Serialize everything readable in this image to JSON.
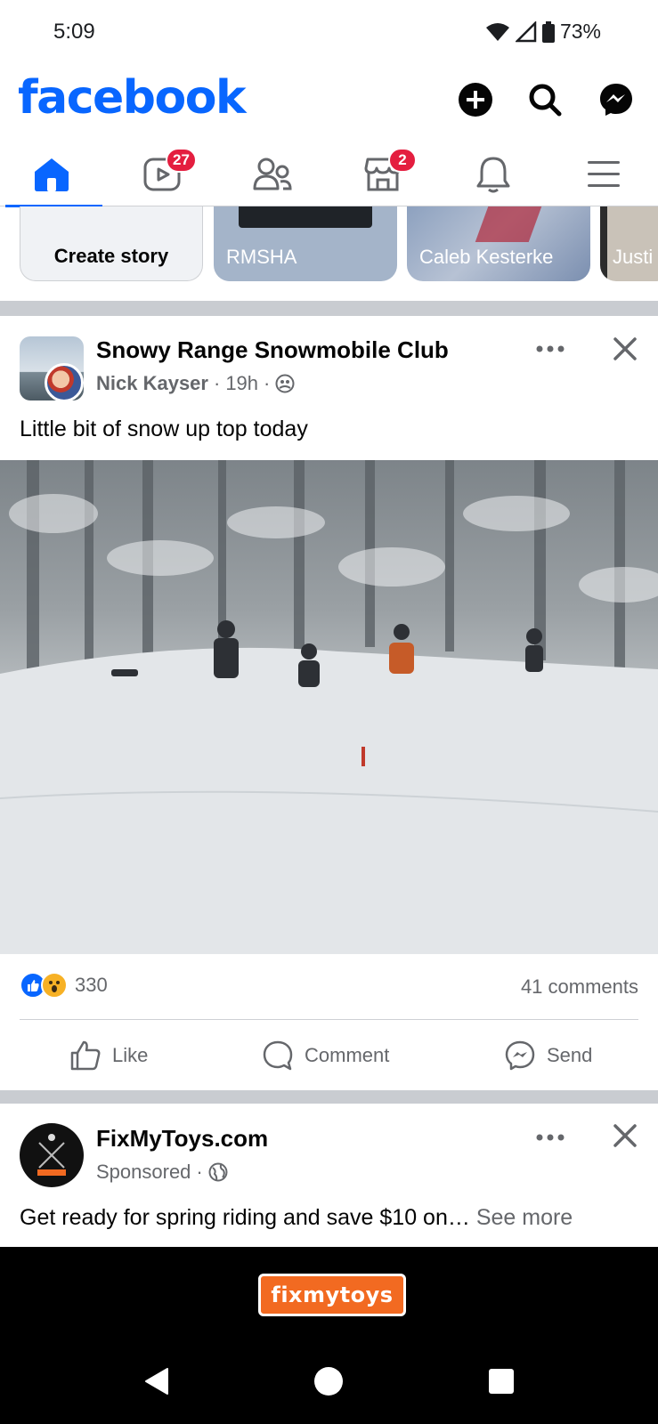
{
  "status_bar": {
    "time": "5:09",
    "battery": "73%"
  },
  "header": {
    "logo": "facebook",
    "icons": [
      "plus-icon",
      "search-icon",
      "messenger-icon"
    ]
  },
  "nav": {
    "tabs": [
      {
        "name": "home",
        "icon": "home-icon",
        "active": true
      },
      {
        "name": "video",
        "icon": "video-icon",
        "badge": "27"
      },
      {
        "name": "friends",
        "icon": "friends-icon"
      },
      {
        "name": "marketplace",
        "icon": "marketplace-icon",
        "badge": "2"
      },
      {
        "name": "notifications",
        "icon": "bell-icon"
      },
      {
        "name": "menu",
        "icon": "menu-icon"
      }
    ]
  },
  "stories": [
    {
      "label": "Create story"
    },
    {
      "label": "RMSHA"
    },
    {
      "label": "Caleb Kesterke"
    },
    {
      "label": "Justi"
    }
  ],
  "post": {
    "group": "Snowy Range Snowmobile Club",
    "author": "Nick Kayser",
    "time": "19h",
    "text": "Little bit of snow up top today",
    "reaction_count": "330",
    "comments": "41 comments",
    "actions": {
      "like": "Like",
      "comment": "Comment",
      "send": "Send"
    }
  },
  "ad": {
    "name": "FixMyToys.com",
    "sponsored": "Sponsored",
    "text": "Get ready for spring riding and save $10 on…",
    "see_more": "See more",
    "banner_logo": "fixmytoys"
  },
  "colors": {
    "brand": "#0866ff",
    "badge": "#e41e3f",
    "secondary_text": "#65676b"
  }
}
